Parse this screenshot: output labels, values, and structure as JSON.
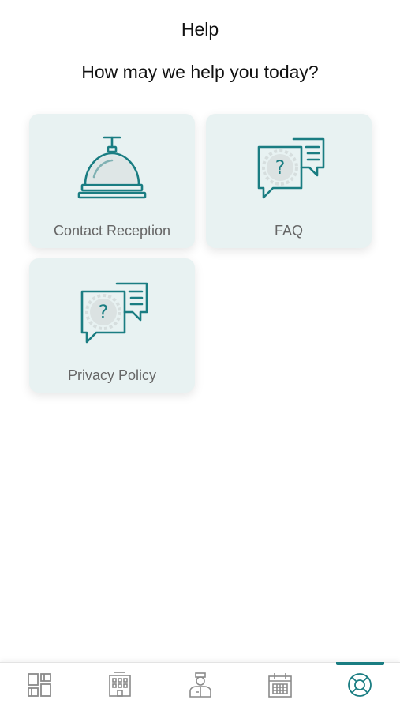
{
  "header": {
    "title": "Help"
  },
  "main": {
    "subtitle": "How may we help you today?",
    "cards": [
      {
        "label": "Contact Reception",
        "icon": "reception-bell-icon"
      },
      {
        "label": "FAQ",
        "icon": "faq-chat-icon"
      },
      {
        "label": "Privacy Policy",
        "icon": "privacy-chat-icon"
      }
    ]
  },
  "tabbar": {
    "items": [
      {
        "icon": "dashboard-icon",
        "active": false
      },
      {
        "icon": "hotel-building-icon",
        "active": false
      },
      {
        "icon": "concierge-person-icon",
        "active": false
      },
      {
        "icon": "calendar-icon",
        "active": false
      },
      {
        "icon": "lifebuoy-help-icon",
        "active": true
      }
    ]
  },
  "colors": {
    "accent": "#1a7d82",
    "card_bg": "#e8f2f2",
    "icon_gray": "#9a9a9a"
  }
}
